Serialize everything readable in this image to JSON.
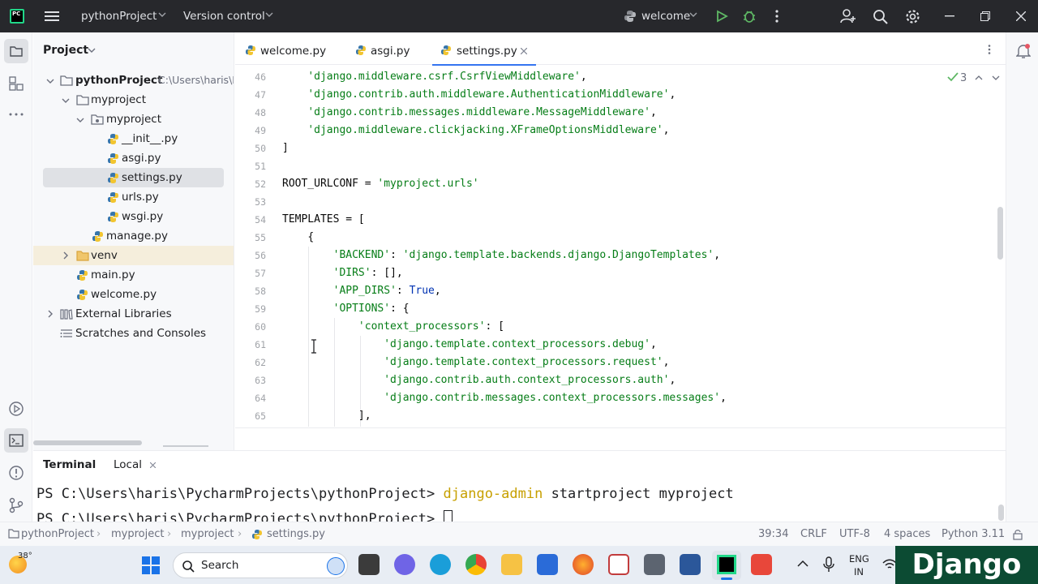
{
  "titlebar": {
    "app_logo": "PC",
    "project_name": "pythonProject",
    "version_control": "Version control",
    "run_config": "welcome"
  },
  "project_panel": {
    "title": "Project",
    "tree": [
      {
        "label": "pythonProject",
        "path": "C:\\Users\\haris\\P",
        "icon": "folder-icon"
      },
      {
        "label": "myproject",
        "icon": "folder-icon"
      },
      {
        "label": "myproject",
        "icon": "package-folder-icon"
      },
      {
        "label": "__init__.py",
        "icon": "python-file-icon"
      },
      {
        "label": "asgi.py",
        "icon": "python-file-icon"
      },
      {
        "label": "settings.py",
        "icon": "python-file-icon"
      },
      {
        "label": "urls.py",
        "icon": "python-file-icon"
      },
      {
        "label": "wsgi.py",
        "icon": "python-file-icon"
      },
      {
        "label": "manage.py",
        "icon": "python-file-icon"
      },
      {
        "label": "venv",
        "icon": "folder-icon"
      },
      {
        "label": "main.py",
        "icon": "python-file-icon"
      },
      {
        "label": "welcome.py",
        "icon": "python-file-icon"
      },
      {
        "label": "External Libraries",
        "icon": "library-icon"
      },
      {
        "label": "Scratches and Consoles",
        "icon": "scratches-icon"
      }
    ]
  },
  "editor": {
    "tabs": [
      {
        "label": "welcome.py"
      },
      {
        "label": "asgi.py"
      },
      {
        "label": "settings.py",
        "active": true
      }
    ],
    "inspection_count": "3",
    "line_numbers": [
      "46",
      "47",
      "48",
      "49",
      "50",
      "51",
      "52",
      "53",
      "54",
      "55",
      "56",
      "57",
      "58",
      "59",
      "60",
      "61",
      "62",
      "63",
      "64",
      "65"
    ],
    "code": {
      "l46": "'django.middleware.csrf.CsrfViewMiddleware'",
      "l47": "'django.contrib.auth.middleware.AuthenticationMiddleware'",
      "l48": "'django.contrib.messages.middleware.MessageMiddleware'",
      "l49": "'django.middleware.clickjacking.XFrameOptionsMiddleware'",
      "l50": "]",
      "l52a": "ROOT_URLCONF = ",
      "l52b": "'myproject.urls'",
      "l54": "TEMPLATES = [",
      "l55": "{",
      "l56a": "'BACKEND'",
      "l56b": "'django.template.backends.django.DjangoTemplates'",
      "l57a": "'DIRS'",
      "l57b": ": [],",
      "l58a": "'APP_DIRS'",
      "l58b": "True",
      "l59a": "'OPTIONS'",
      "l59b": ": {",
      "l60a": "'context_processors'",
      "l60b": ": [",
      "l61": "'django.template.context_processors.debug'",
      "l62": "'django.template.context_processors.request'",
      "l63": "'django.contrib.auth.context_processors.auth'",
      "l64": "'django.contrib.messages.context_processors.messages'",
      "l65": "],"
    }
  },
  "terminal": {
    "title": "Terminal",
    "tab": "Local",
    "line1_prompt": "PS C:\\Users\\haris\\PycharmProjects\\pythonProject> ",
    "line1_cmd": "django-admin",
    "line1_args": " startproject myproject",
    "line2_prompt": "PS C:\\Users\\haris\\PycharmProjects\\pythonProject> "
  },
  "statusbar": {
    "breadcrumbs": [
      "pythonProject",
      "myproject",
      "myproject",
      "settings.py"
    ],
    "position": "39:34",
    "line_ending": "CRLF",
    "encoding": "UTF-8",
    "indent": "4 spaces",
    "interpreter": "Python 3.11"
  },
  "taskbar": {
    "weather_temp": "38°",
    "search_placeholder": "Search",
    "language_line1": "ENG",
    "language_line2": "IN"
  },
  "watermark": "Django",
  "colors": {
    "accent": "#3574f0",
    "string": "#067d17",
    "keyword": "#0033b3",
    "django_green": "#0c4b33"
  }
}
